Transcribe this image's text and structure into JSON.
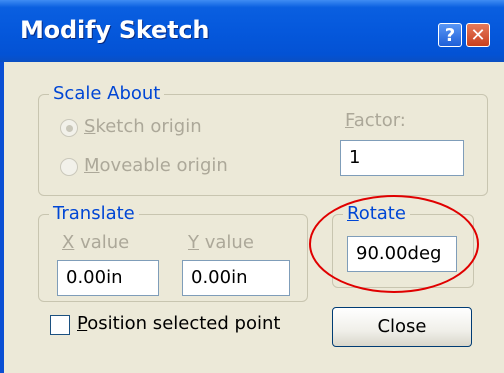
{
  "window": {
    "title": "Modify Sketch",
    "help_glyph": "?",
    "close_glyph": "✕"
  },
  "scale_about": {
    "title": "Scale About",
    "sketch_origin_prefix": "",
    "sketch_origin_underline": "S",
    "sketch_origin_rest": "ketch origin",
    "moveable_origin_underline": "M",
    "moveable_origin_rest": "oveable origin",
    "factor_underline": "F",
    "factor_rest": "actor:",
    "factor_value": "1"
  },
  "translate": {
    "title": "Translate",
    "x_underline": "X",
    "x_rest": " value",
    "y_underline": "Y",
    "y_rest": " value",
    "x_value": "0.00in",
    "y_value": "0.00in"
  },
  "rotate": {
    "title_underline": "R",
    "title_rest": "otate",
    "value": "90.00deg"
  },
  "position_selected_point": {
    "underline": "P",
    "rest": "osition selected point"
  },
  "close_button": "Close",
  "colors": {
    "group_title": "#0046d5",
    "annotation": "#e00000",
    "title_bar": "#0558dc"
  }
}
